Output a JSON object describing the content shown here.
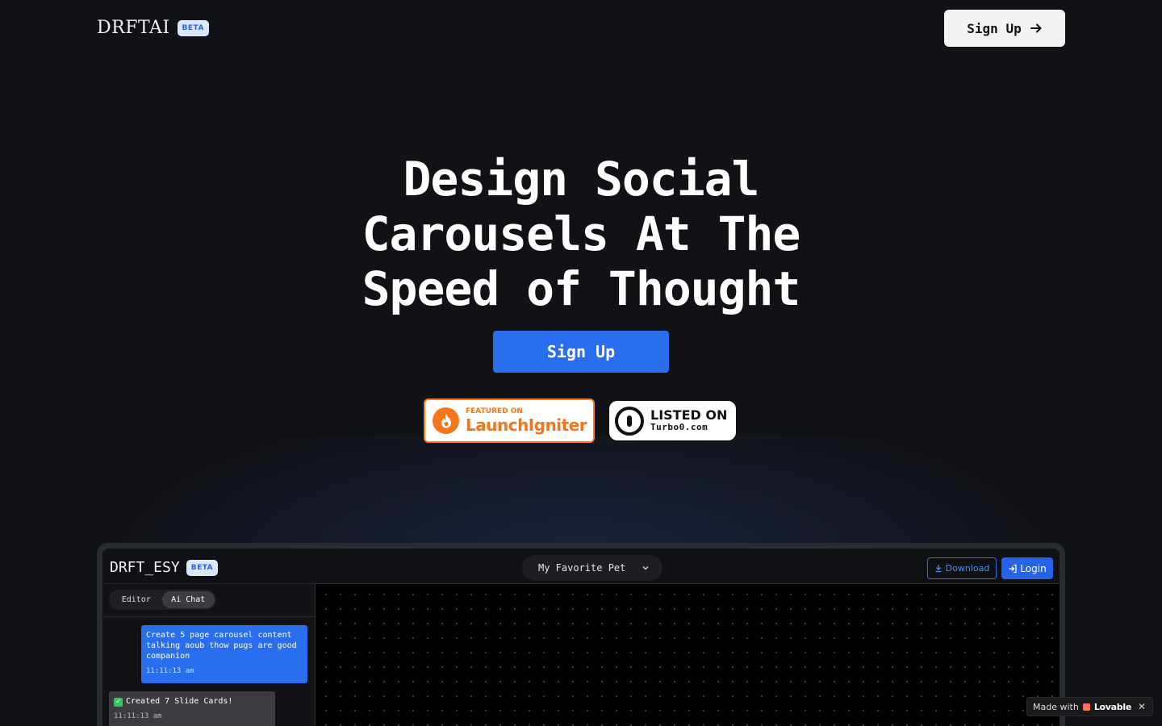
{
  "nav": {
    "brand": "DRFTAI",
    "badge": "BETA",
    "signup_label": "Sign Up",
    "signup_icon": "arrow-right-icon"
  },
  "hero": {
    "title_line1": "Design Social",
    "title_line2": "Carousels At The",
    "title_line3": "Speed of Thought",
    "cta_label": "Sign Up"
  },
  "badges": {
    "launchigniter_small": "FEATURED ON",
    "launchigniter_big": "LaunchIgniter",
    "turbo_big": "LISTED ON",
    "turbo_small": "Turbo0.com"
  },
  "app": {
    "brand": "DRFT_ESY",
    "badge": "BETA",
    "project_select": "My Favorite Pet",
    "download_label": "Download",
    "login_label": "Login",
    "tabs": [
      {
        "label": "Editor"
      },
      {
        "label": "Ai Chat"
      }
    ],
    "messages": [
      {
        "text": "Create 5 page carousel content talking aoub thow pugs are good companion",
        "time": "11:11:13 am"
      },
      {
        "text": "Created 7 Slide Cards!",
        "time": "11:11:13 am"
      }
    ]
  },
  "lovable": {
    "prefix": "Made with",
    "brand": "Lovable",
    "close": "✕"
  },
  "colors": {
    "background": "#111216",
    "accent": "#2a6ef0",
    "launchigniter": "#f5761a"
  }
}
